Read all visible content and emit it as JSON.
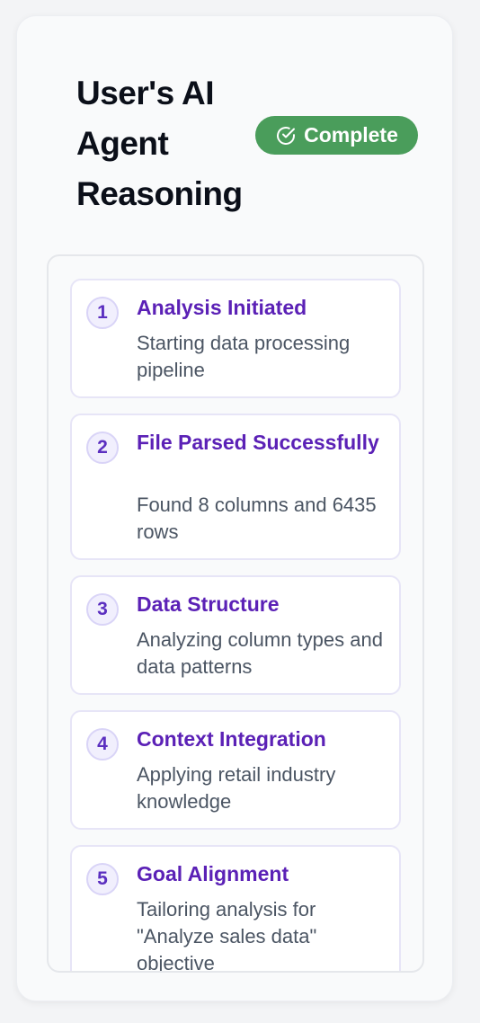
{
  "header": {
    "title": "User's AI Agent Reasoning",
    "status": {
      "label": "Complete",
      "icon": "check-circle-icon",
      "color": "#4a9d5b"
    }
  },
  "steps": [
    {
      "number": "1",
      "title": "Analysis Initiated",
      "description": "Starting data processing pipeline"
    },
    {
      "number": "2",
      "title": "File Parsed Successfully",
      "description": "Found 8 columns and 6435 rows"
    },
    {
      "number": "3",
      "title": "Data Structure",
      "description": "Analyzing column types and data patterns"
    },
    {
      "number": "4",
      "title": "Context Integration",
      "description": "Applying retail industry knowledge"
    },
    {
      "number": "5",
      "title": "Goal Alignment",
      "description": "Tailoring analysis for \"Analyze sales data\" objective"
    }
  ],
  "colors": {
    "accent": "#5b21b6",
    "success": "#4a9d5b"
  }
}
